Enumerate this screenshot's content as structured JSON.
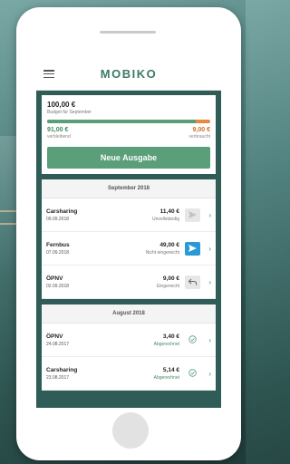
{
  "app": {
    "title": "MOBIKO"
  },
  "budget": {
    "amount": "100,00 €",
    "subtitle": "Budget für September",
    "progress_fraction": 0.91,
    "remaining_value": "91,00 €",
    "remaining_label": "verbleibend",
    "used_value": "9,00 €",
    "used_label": "verbraucht",
    "new_expense_label": "Neue Ausgabe"
  },
  "months": [
    {
      "title": "September 2018",
      "entries": [
        {
          "name": "Carsharing",
          "date": "09.09.2018",
          "amount": "11,40 €",
          "status": "Unvollständig",
          "action_icon": "send-icon",
          "action_style": "light"
        },
        {
          "name": "Fernbus",
          "date": "07.09.2018",
          "amount": "49,00 €",
          "status": "Nicht eingereicht",
          "action_icon": "send-icon",
          "action_style": "blue"
        },
        {
          "name": "ÖPNV",
          "date": "02.09.2018",
          "amount": "9,00 €",
          "status": "Eingereicht",
          "action_icon": "undo-icon",
          "action_style": "light"
        }
      ]
    },
    {
      "title": "August 2018",
      "entries": [
        {
          "name": "ÖPNV",
          "date": "24.08.2017",
          "amount": "3,40 €",
          "status": "Abgerechnet",
          "action_icon": "check-circle-icon",
          "action_style": "none"
        },
        {
          "name": "Carsharing",
          "date": "23.08.2017",
          "amount": "5,14 €",
          "status": "Abgerechnet",
          "action_icon": "check-circle-icon",
          "action_style": "none"
        }
      ]
    }
  ],
  "colors": {
    "brand": "#3a7a68",
    "accent_green": "#5a9e7a",
    "accent_orange": "#e8893e",
    "action_blue": "#2a9ad6"
  }
}
